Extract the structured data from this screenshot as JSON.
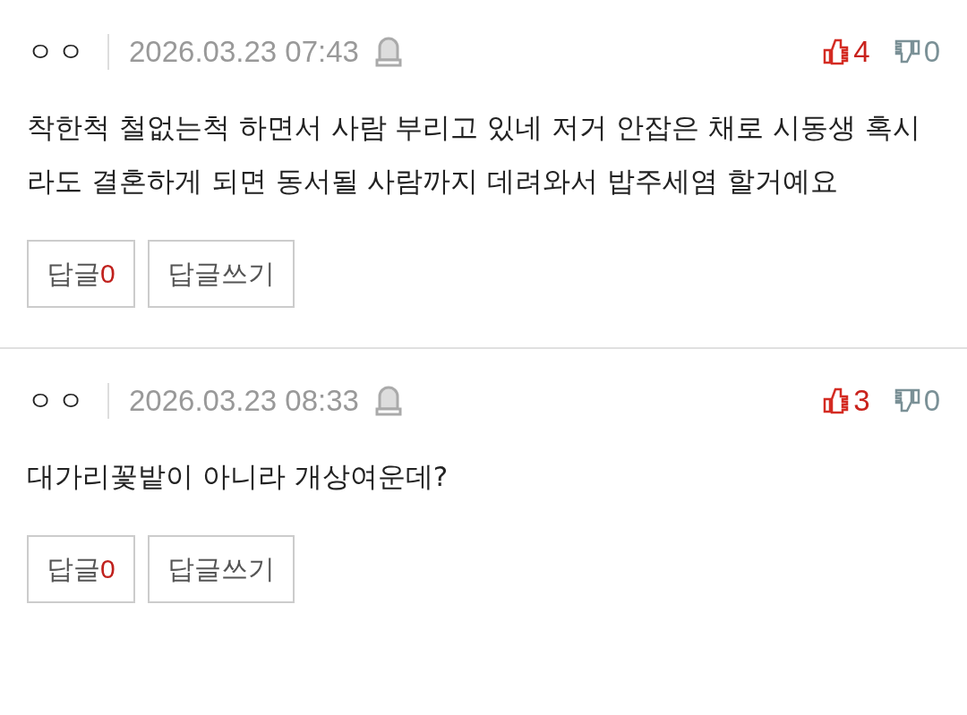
{
  "comments": [
    {
      "author": "ㅇㅇ",
      "date": "2026.03.23 07:43",
      "likes": "4",
      "dislikes": "0",
      "text": "착한척 철없는척 하면서 사람 부리고 있네 저거 안잡은 채로 시동생 혹시라도 결혼하게 되면 동서될 사람까지 데려와서 밥주세염 할거예요",
      "reply_label": "답글",
      "reply_count": "0",
      "write_label": "답글쓰기"
    },
    {
      "author": "ㅇㅇ",
      "date": "2026.03.23 08:33",
      "likes": "3",
      "dislikes": "0",
      "text": "대가리꽃밭이 아니라 개상여운데?",
      "reply_label": "답글",
      "reply_count": "0",
      "write_label": "답글쓰기"
    }
  ]
}
